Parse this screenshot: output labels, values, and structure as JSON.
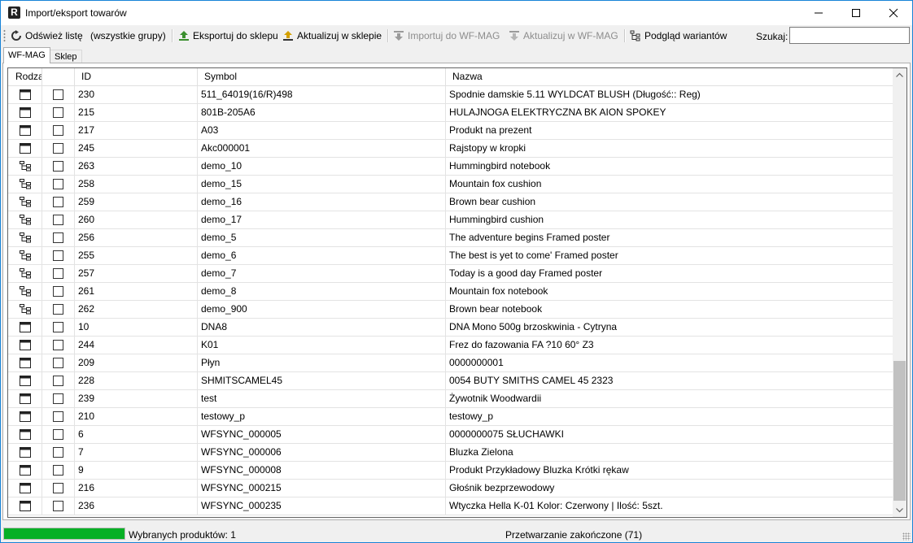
{
  "window": {
    "title": "Import/eksport towarów",
    "app_icon": "R"
  },
  "toolbar": {
    "refresh_label": "Odśwież listę",
    "group_label": "(wszystkie grupy)",
    "export_label": "Eksportuj do sklepu",
    "update_shop_label": "Aktualizuj w sklepie",
    "import_label": "Importuj do WF-MAG",
    "update_wfmag_label": "Aktualizuj w WF-MAG",
    "variants_label": "Podgląd wariantów",
    "search_label": "Szukaj:",
    "search_value": ""
  },
  "tabs": [
    {
      "label": "WF-MAG"
    },
    {
      "label": "Sklep"
    }
  ],
  "grid": {
    "columns": [
      "Rodzaj",
      "",
      "ID",
      "Symbol",
      "Nazwa"
    ],
    "rows": [
      {
        "kind": "product",
        "id": "230",
        "symbol": "511_64019(16/R)498",
        "name": "Spodnie damskie 5.11 WYLDCAT BLUSH (Długość:: Reg)"
      },
      {
        "kind": "product",
        "id": "215",
        "symbol": "801B-205A6",
        "name": "HULAJNOGA ELEKTRYCZNA BK AION SPOKEY"
      },
      {
        "kind": "product",
        "id": "217",
        "symbol": "A03",
        "name": "Produkt na prezent"
      },
      {
        "kind": "product",
        "id": "245",
        "symbol": "Akc000001",
        "name": "Rajstopy w kropki"
      },
      {
        "kind": "variant",
        "id": "263",
        "symbol": "demo_10",
        "name": "Hummingbird notebook"
      },
      {
        "kind": "variant",
        "id": "258",
        "symbol": "demo_15",
        "name": "Mountain fox cushion"
      },
      {
        "kind": "variant",
        "id": "259",
        "symbol": "demo_16",
        "name": "Brown bear cushion"
      },
      {
        "kind": "variant",
        "id": "260",
        "symbol": "demo_17",
        "name": "Hummingbird cushion"
      },
      {
        "kind": "variant",
        "id": "256",
        "symbol": "demo_5",
        "name": "The adventure begins Framed poster"
      },
      {
        "kind": "variant",
        "id": "255",
        "symbol": "demo_6",
        "name": "The best is yet to come' Framed poster"
      },
      {
        "kind": "variant",
        "id": "257",
        "symbol": "demo_7",
        "name": "Today is a good day Framed poster"
      },
      {
        "kind": "variant",
        "id": "261",
        "symbol": "demo_8",
        "name": "Mountain fox notebook"
      },
      {
        "kind": "variant",
        "id": "262",
        "symbol": "demo_900",
        "name": "Brown bear notebook"
      },
      {
        "kind": "product",
        "id": "10",
        "symbol": "DNA8",
        "name": "DNA Mono 500g brzoskwinia - Cytryna"
      },
      {
        "kind": "product",
        "id": "244",
        "symbol": "K01",
        "name": "Frez do fazowania FA ?10 60° Z3"
      },
      {
        "kind": "product",
        "id": "209",
        "symbol": "Płyn",
        "name": "0000000001"
      },
      {
        "kind": "product",
        "id": "228",
        "symbol": "SHMITSCAMEL45",
        "name": "0054 BUTY SMITHS CAMEL 45 2323"
      },
      {
        "kind": "product",
        "id": "239",
        "symbol": "test",
        "name": "Żywotnik Woodwardii"
      },
      {
        "kind": "product",
        "id": "210",
        "symbol": "testowy_p",
        "name": "testowy_p"
      },
      {
        "kind": "product",
        "id": "6",
        "symbol": "WFSYNC_000005",
        "name": "0000000075 SŁUCHAWKI"
      },
      {
        "kind": "product",
        "id": "7",
        "symbol": "WFSYNC_000006",
        "name": "Bluzka Zielona"
      },
      {
        "kind": "product",
        "id": "9",
        "symbol": "WFSYNC_000008",
        "name": "Produkt Przykładowy Bluzka Krótki rękaw"
      },
      {
        "kind": "product",
        "id": "216",
        "symbol": "WFSYNC_000215",
        "name": "Głośnik bezprzewodowy"
      },
      {
        "kind": "product",
        "id": "236",
        "symbol": "WFSYNC_000235",
        "name": "Wtyczka Hella K-01 Kolor: Czerwony | Ilość: 5szt."
      }
    ]
  },
  "status": {
    "progress_fraction": 1.0,
    "selected_text": "Wybranych produktów: 1",
    "process_text": "Przetwarzanie zakończone (71)"
  },
  "colors": {
    "accent": "#1883d7",
    "progress": "#06b025",
    "export_icon": "#3a8f2e",
    "update_icon": "#d4a000"
  }
}
